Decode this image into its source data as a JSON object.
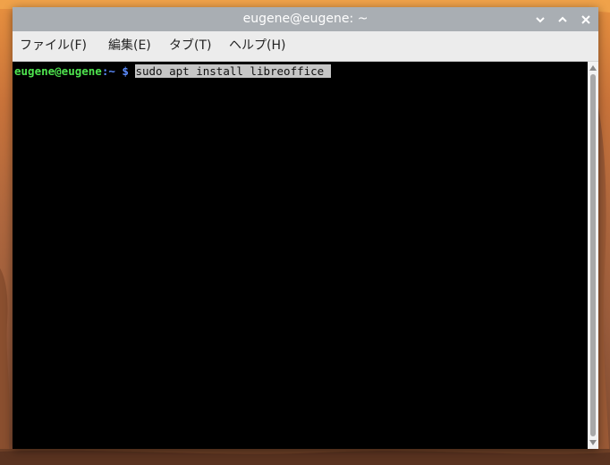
{
  "window": {
    "title": "eugene@eugene: ~",
    "controls": [
      "chevron-down-icon",
      "chevron-up-icon",
      "close-icon"
    ]
  },
  "menu": {
    "items": [
      {
        "label": "ファイル(F)"
      },
      {
        "label": "編集(E)"
      },
      {
        "label": "タブ(T)"
      },
      {
        "label": "ヘルプ(H)"
      }
    ]
  },
  "terminal": {
    "prompt_user": "eugene@eugene",
    "prompt_path": ":~ $",
    "command": "sudo apt install libreoffice"
  },
  "colors": {
    "titlebar": "#a9aeb3",
    "menubar": "#ececec",
    "terminal_bg": "#000000",
    "prompt_user": "#4ee34e",
    "prompt_path": "#5c8cff",
    "selection": "#c6c6c6"
  }
}
